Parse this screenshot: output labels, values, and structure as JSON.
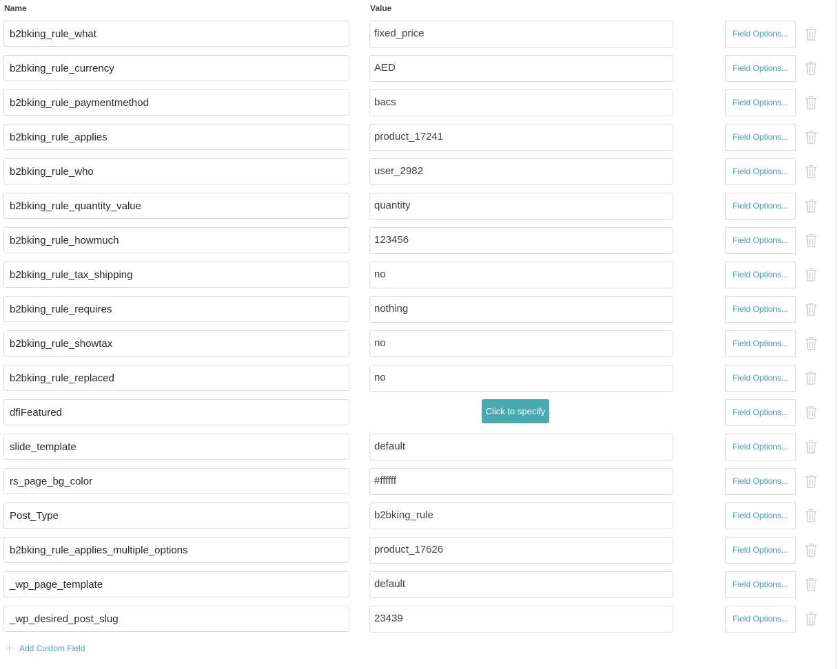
{
  "headers": {
    "name": "Name",
    "value": "Value"
  },
  "options_label": "Field Options...",
  "specify_label": "Click to specify",
  "add_custom_field_label": "Add Custom Field",
  "accent_color": "#47aab0",
  "fields": [
    {
      "name": "b2bking_rule_what",
      "value": "fixed_price"
    },
    {
      "name": "b2bking_rule_currency",
      "value": "AED"
    },
    {
      "name": "b2bking_rule_paymentmethod",
      "value": "bacs"
    },
    {
      "name": "b2bking_rule_applies",
      "value": "product_17241"
    },
    {
      "name": "b2bking_rule_who",
      "value": "user_2982"
    },
    {
      "name": "b2bking_rule_quantity_value",
      "value": "quantity"
    },
    {
      "name": "b2bking_rule_howmuch",
      "value": "123456"
    },
    {
      "name": "b2bking_rule_tax_shipping",
      "value": "no"
    },
    {
      "name": "b2bking_rule_requires",
      "value": "nothing"
    },
    {
      "name": "b2bking_rule_showtax",
      "value": "no"
    },
    {
      "name": "b2bking_rule_replaced",
      "value": "no"
    },
    {
      "name": "dfiFeatured",
      "value": null
    },
    {
      "name": "slide_template",
      "value": "default"
    },
    {
      "name": "rs_page_bg_color",
      "value": "#ffffff"
    },
    {
      "name": "Post_Type",
      "value": "b2bking_rule"
    },
    {
      "name": "b2bking_rule_applies_multiple_options",
      "value": "product_17626"
    },
    {
      "name": "_wp_page_template",
      "value": "default"
    },
    {
      "name": "_wp_desired_post_slug",
      "value": "23439"
    }
  ]
}
